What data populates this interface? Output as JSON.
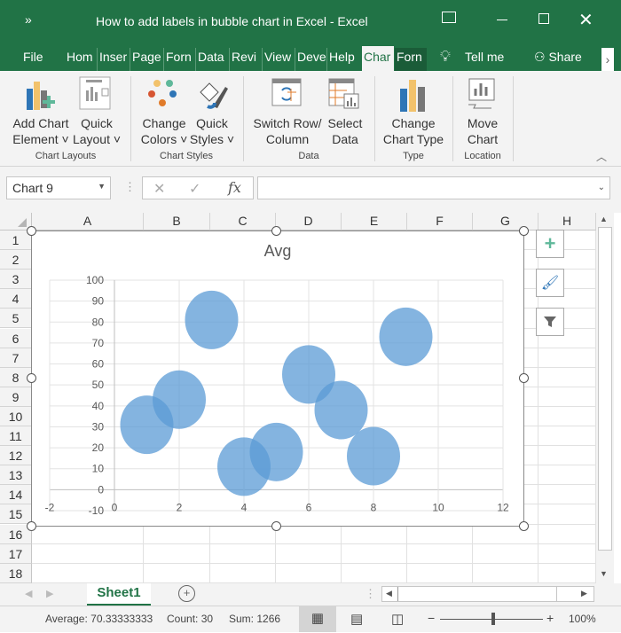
{
  "window": {
    "title": "How to add labels in bubble chart in Excel  -  Excel",
    "controls": [
      "ribbon-display",
      "minimize",
      "maximize",
      "close"
    ]
  },
  "tabs": [
    "File",
    "Hom",
    "Inser",
    "Page",
    "Forn",
    "Data",
    "Revi",
    "View",
    "Deve",
    "Help",
    "Char",
    "Forn"
  ],
  "active_tab": "Char",
  "tell_me": "Tell me",
  "share": "Share",
  "ribbon": {
    "buttons": [
      {
        "l1": "Add Chart",
        "l2": "Element ˅"
      },
      {
        "l1": "Quick",
        "l2": "Layout ˅"
      },
      {
        "l1": "Change",
        "l2": "Colors ˅"
      },
      {
        "l1": "Quick",
        "l2": "Styles ˅"
      },
      {
        "l1": "Switch Row/",
        "l2": "Column"
      },
      {
        "l1": "Select",
        "l2": "Data"
      },
      {
        "l1": "Change",
        "l2": "Chart Type"
      },
      {
        "l1": "Move",
        "l2": "Chart"
      }
    ],
    "groups": [
      "Chart Layouts",
      "Chart Styles",
      "Data",
      "Type",
      "Location"
    ]
  },
  "namebox": "Chart 9",
  "formula": "",
  "columns": [
    "A",
    "B",
    "C",
    "D",
    "E",
    "F",
    "G",
    "H"
  ],
  "rows": [
    "1",
    "2",
    "3",
    "4",
    "5",
    "6",
    "7",
    "8",
    "9",
    "10",
    "11",
    "12",
    "13",
    "14",
    "15",
    "16",
    "17",
    "18"
  ],
  "sheet_tab": "Sheet1",
  "status": {
    "average": "Average: 70.33333333",
    "count": "Count: 30",
    "sum": "Sum: 1266",
    "zoom": "100%",
    "zoom_fraction": 0.5
  },
  "chart_data": {
    "type": "bubble",
    "title": "Avg",
    "x": [
      1,
      2,
      3,
      4,
      5,
      6,
      7,
      8,
      9
    ],
    "y": [
      31,
      43,
      81,
      11,
      18,
      55,
      38,
      16,
      73
    ],
    "xlim": [
      -2,
      12
    ],
    "ylim": [
      -10,
      100
    ],
    "xticks": [
      "-2",
      "0",
      "2",
      "4",
      "6",
      "8",
      "10",
      "12"
    ],
    "yticks": [
      "100",
      "90",
      "80",
      "70",
      "60",
      "50",
      "40",
      "30",
      "20",
      "10",
      "0",
      "-10"
    ],
    "color": "#5b9bd5",
    "grid": true
  }
}
